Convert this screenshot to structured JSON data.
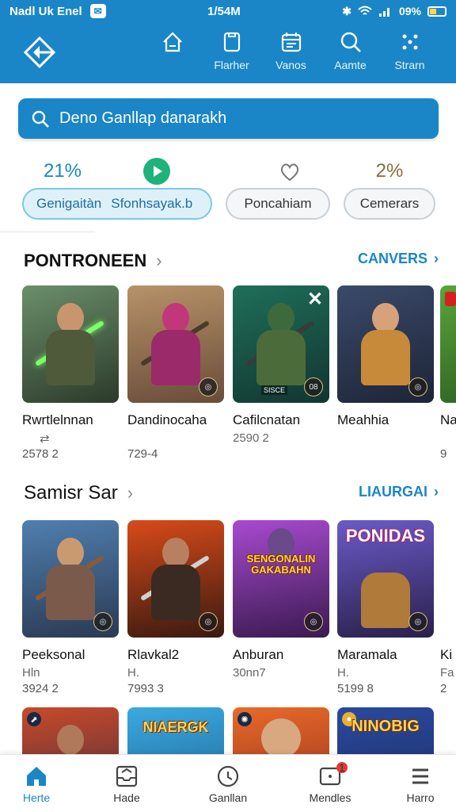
{
  "status_bar": {
    "carrier": "Nadl Uk Enel",
    "time": "1/54M",
    "battery": "09%"
  },
  "app_bar": {
    "actions": [
      {
        "label": "",
        "icon": "home-outline-icon"
      },
      {
        "label": "Flarher",
        "icon": "clipboard-icon"
      },
      {
        "label": "Vanos",
        "icon": "calendar-icon"
      },
      {
        "label": "Aamte",
        "icon": "search-icon"
      },
      {
        "label": "Strarn",
        "icon": "dots-grid-icon"
      }
    ]
  },
  "search": {
    "placeholder": "Deno Ganllap danarakh"
  },
  "filters": {
    "top_items": [
      "21%",
      "",
      "",
      "2%"
    ],
    "chips": [
      {
        "label": "Genigaitàn",
        "active": true
      },
      {
        "label": "Sfonhsayak.b",
        "active": false
      },
      {
        "label": "Poncahiam",
        "active": false
      },
      {
        "label": "Cemerars",
        "active": false
      }
    ]
  },
  "sections": [
    {
      "title": "PONTRONEEN",
      "link": "CANVERS",
      "cards": [
        {
          "title": "Rwrtlelnnan",
          "sub": "",
          "meta": "2578 2"
        },
        {
          "title": "Dandinocaha",
          "sub": "",
          "meta": "729-4"
        },
        {
          "title": "Cafilcnatan",
          "sub": "",
          "meta": "2590 2"
        },
        {
          "title": "Meahhia",
          "sub": "",
          "meta": ""
        },
        {
          "title": "Na",
          "sub": "",
          "meta": "9"
        }
      ]
    },
    {
      "title": "Samisr Sar",
      "link": "LIAURGAI",
      "cards": [
        {
          "title": "Peeksonal",
          "sub": "Hln",
          "meta": "3924 2"
        },
        {
          "title": "Rlavkal2",
          "sub": "H.",
          "meta": "7993 3"
        },
        {
          "title": "Anburan",
          "sub": "",
          "meta": "30nn7"
        },
        {
          "title": "Maramala",
          "sub": "H.",
          "meta": "5199 8"
        },
        {
          "title": "Ki",
          "sub": "Fa",
          "meta": "2"
        }
      ]
    }
  ],
  "card_banners": {
    "s1c2_strip": "SISCE",
    "s1c2_badge": "08",
    "s2c2_banner": "SENGONALIN GAKABAHN",
    "s2c3_banner": "PONIDAS",
    "s3c3_banner": "NINOBIG",
    "s3c1_banner": "NIAERGK"
  },
  "bottom_nav": [
    {
      "label": "Herte",
      "icon": "home-icon",
      "active": true
    },
    {
      "label": "Hade",
      "icon": "inbox-icon",
      "active": false
    },
    {
      "label": "Ganllan",
      "icon": "clock-icon",
      "active": false
    },
    {
      "label": "Mendles",
      "icon": "tablet-icon",
      "active": false,
      "badge": "1"
    },
    {
      "label": "Harro",
      "icon": "menu-icon",
      "active": false
    }
  ],
  "colors": {
    "primary": "#1a86c7",
    "accent_green": "#1db37a"
  }
}
